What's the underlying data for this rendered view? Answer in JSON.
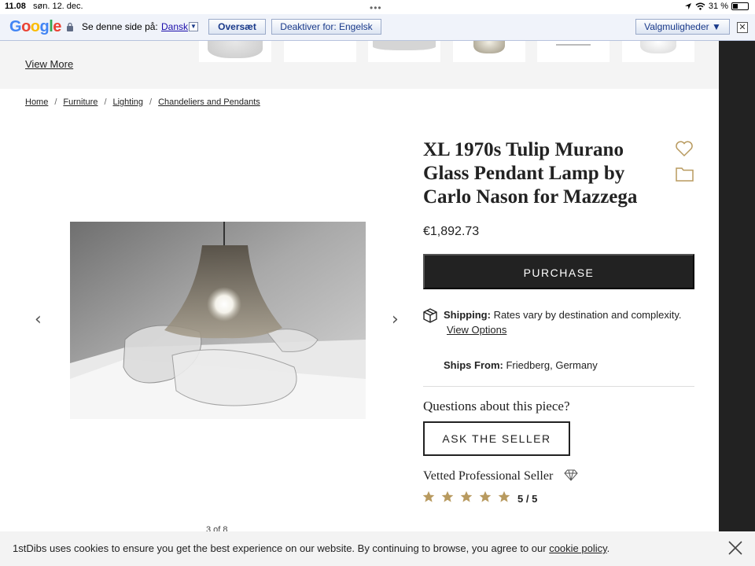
{
  "status_bar": {
    "time": "11.08",
    "date": "søn. 12. dec.",
    "battery": "31 %",
    "battery_level": 0.31
  },
  "translate_bar": {
    "logo": "Google",
    "prompt": "Se denne side på:",
    "language": "Dansk",
    "translate_button": "Oversæt",
    "disable_button": "Deaktiver for: Engelsk",
    "options_button": "Valgmuligheder ▼"
  },
  "carousel": {
    "view_more": "View More"
  },
  "breadcrumb": [
    "Home",
    "Furniture",
    "Lighting",
    "Chandeliers and Pendants"
  ],
  "product": {
    "title": "XL 1970s Tulip Murano Glass Pendant Lamp by Carlo Nason for Mazzega",
    "price": "€1,892.73",
    "purchase_label": "PURCHASE",
    "image_counter": "3 of 8"
  },
  "shipping": {
    "label": "Shipping:",
    "text": "Rates vary by destination and complexity.",
    "view_options": "View Options",
    "ships_from_label": "Ships From:",
    "ships_from_value": "Friedberg, Germany"
  },
  "seller": {
    "questions": "Questions about this piece?",
    "ask_label": "ASK THE SELLER",
    "vetted": "Vetted Professional Seller",
    "rating": "5 / 5",
    "stars": 5
  },
  "cookie": {
    "text": "1stDibs uses cookies to ensure you get the best experience on our website. By continuing to browse, you agree to our",
    "link": "cookie policy",
    "period": "."
  },
  "colors": {
    "gold": "#b89a5f",
    "dark": "#222222",
    "google_bar": "#f0f3fa"
  }
}
